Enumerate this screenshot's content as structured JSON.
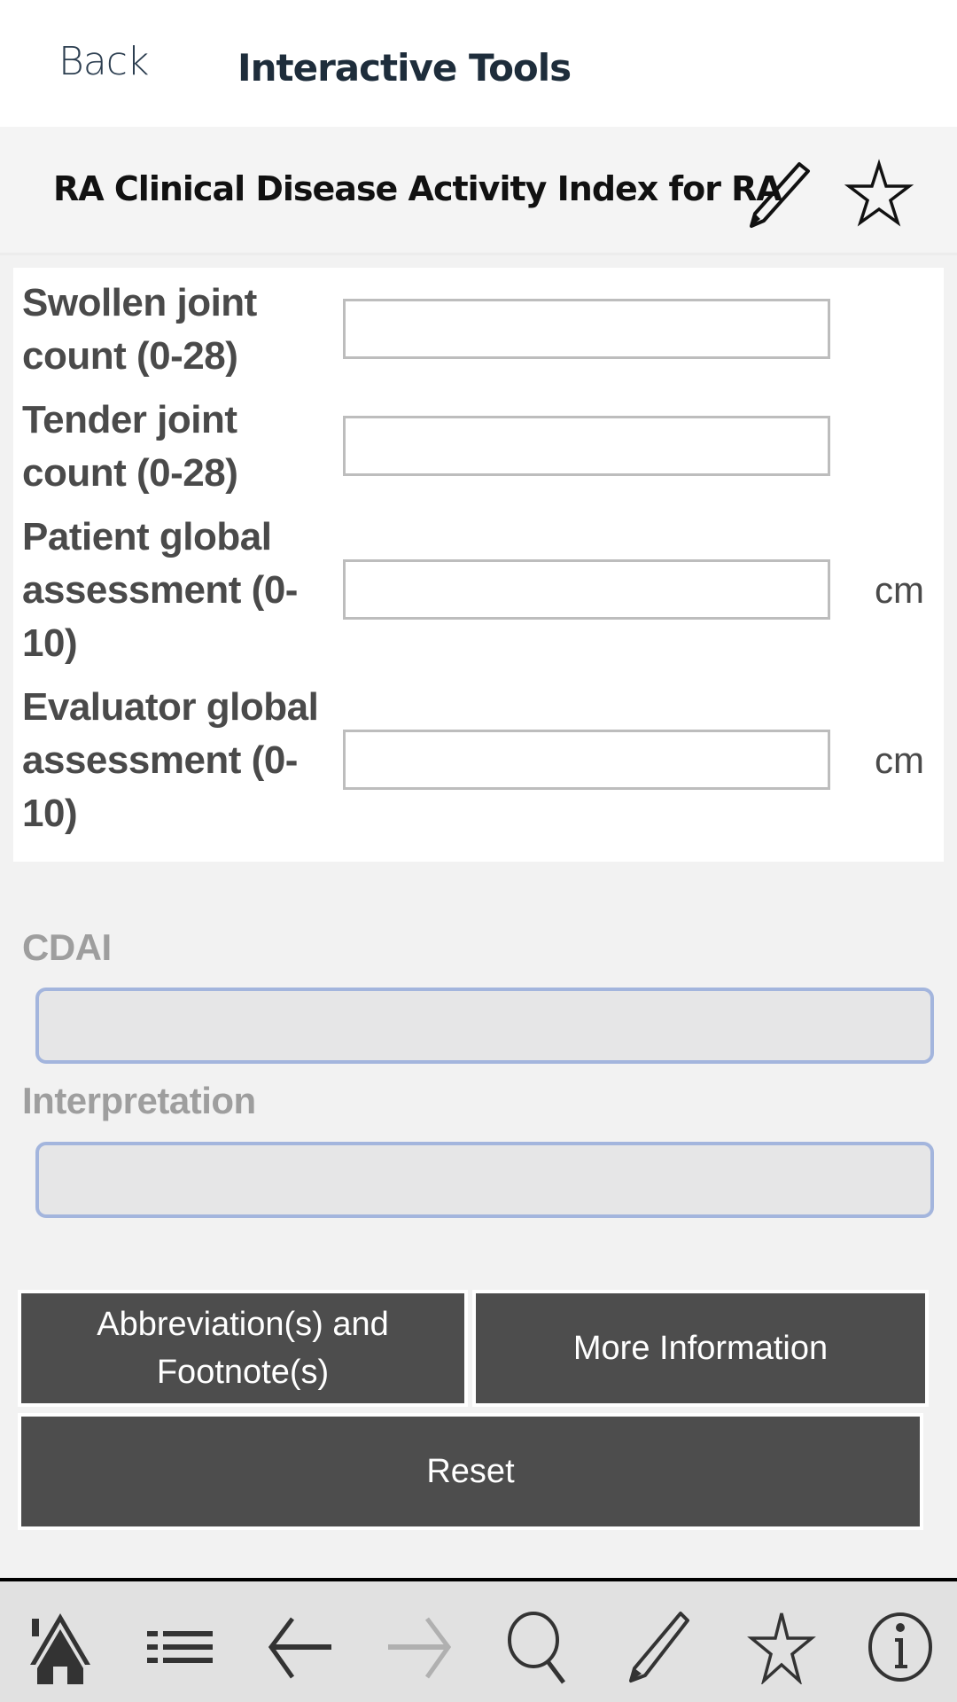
{
  "header": {
    "back_label": "Back",
    "title": "Interactive Tools"
  },
  "tool": {
    "title": "RA Clinical Disease Activity Index for RA",
    "icons": [
      "pencil-icon",
      "star-icon"
    ]
  },
  "form": {
    "fields": [
      {
        "label": "Swollen joint count (0-28)",
        "value": "",
        "unit": ""
      },
      {
        "label": "Tender joint count (0-28)",
        "value": "",
        "unit": ""
      },
      {
        "label": "Patient global assessment (0-10)",
        "value": "",
        "unit": "cm"
      },
      {
        "label": "Evaluator global assessment (0-10)",
        "value": "",
        "unit": "cm"
      }
    ]
  },
  "results": {
    "cdai_label": "CDAI",
    "cdai_value": "",
    "interpretation_label": "Interpretation",
    "interpretation_value": ""
  },
  "buttons": {
    "abbrev": "Abbreviation(s) and Footnote(s)",
    "more_info": "More Information",
    "reset": "Reset"
  },
  "nav": {
    "items": [
      "home-icon",
      "list-icon",
      "back-arrow-icon",
      "forward-arrow-icon",
      "search-icon",
      "pencil-icon",
      "star-icon",
      "info-icon"
    ],
    "forward_disabled": true
  },
  "colors": {
    "button_bg": "#4d4d4d",
    "result_border": "#a3b5dd",
    "header_text": "#1e2d3b"
  }
}
